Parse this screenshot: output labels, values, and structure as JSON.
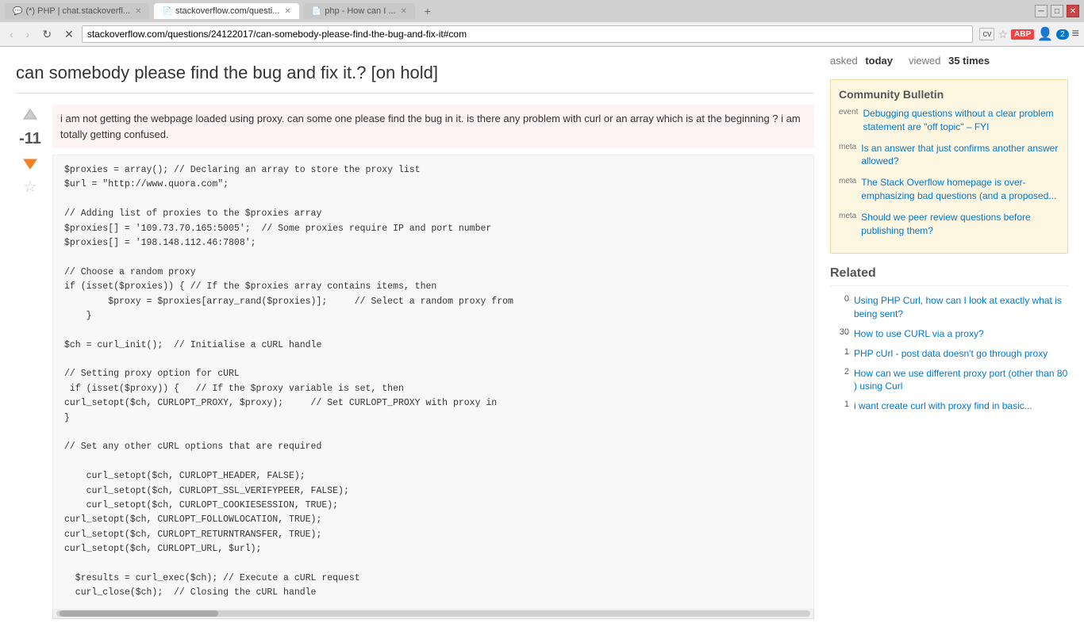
{
  "browser": {
    "tabs": [
      {
        "id": "tab1",
        "label": "(*) PHP | chat.stackoverfl...",
        "favicon": "💬",
        "active": false
      },
      {
        "id": "tab2",
        "label": "stackoverflow.com/questi...",
        "favicon": "📄",
        "active": true
      },
      {
        "id": "tab3",
        "label": "php - How can I ...",
        "favicon": "📄",
        "active": false
      }
    ],
    "win_controls": [
      "─",
      "□",
      "✕"
    ],
    "address": "stackoverflow.com/questions/24122017/can-somebody-please-find-the-bug-and-fix-it#com",
    "nav_icons": [
      "cv",
      "★",
      "ABP",
      "👤",
      "2",
      "≡"
    ]
  },
  "page": {
    "title": "can somebody please find the bug and fix it.? [on hold]",
    "vote_count": "-11",
    "asked_label": "asked",
    "asked_value": "today",
    "viewed_label": "viewed",
    "viewed_value": "35 times",
    "question_text_part1": "i am not getting the webpage loaded using proxy. can some one please find the bug in it. is there any problem with curl or an array which is at the beginning ? i am totally getting confused.",
    "code": "$proxies = array(); // Declaring an array to store the proxy list\n$url = \"http://www.quora.com\";\n\n// Adding list of proxies to the $proxies array\n$proxies[] = '109.73.70.165:5005';  // Some proxies require IP and port number\n$proxies[] = '198.148.112.46:7808';\n\n// Choose a random proxy\nif (isset($proxies)) { // If the $proxies array contains items, then\n        $proxy = $proxies[array_rand($proxies)];     // Select a random proxy from\n    }\n\n$ch = curl_init();  // Initialise a cURL handle\n\n// Setting proxy option for cURL\n if (isset($proxy)) {   // If the $proxy variable is set, then\ncurl_setopt($ch, CURLOPT_PROXY, $proxy);     // Set CURLOPT_PROXY with proxy in\n}\n\n// Set any other cURL options that are required\n\n    curl_setopt($ch, CURLOPT_HEADER, FALSE);\n    curl_setopt($ch, CURLOPT_SSL_VERIFYPEER, FALSE);\n    curl_setopt($ch, CURLOPT_COOKIESESSION, TRUE);\ncurl_setopt($ch, CURLOPT_FOLLOWLOCATION, TRUE);\ncurl_setopt($ch, CURLOPT_RETURNTRANSFER, TRUE);\ncurl_setopt($ch, CURLOPT_URL, $url);\n\n  $results = curl_exec($ch); // Execute a cURL request\n  curl_close($ch);  // Closing the cURL handle"
  },
  "community_bulletin": {
    "title": "Community Bulletin",
    "items": [
      {
        "tag": "event",
        "text": "Debugging questions without a clear problem statement are \"off topic\" – FYI"
      },
      {
        "tag": "meta",
        "text": "Is an answer that just confirms another answer allowed?"
      },
      {
        "tag": "meta",
        "text": "The Stack Overflow homepage is over-emphasizing bad questions (and a proposed..."
      },
      {
        "tag": "meta",
        "text": "Should we peer review questions before publishing them?"
      }
    ]
  },
  "related": {
    "title": "Related",
    "items": [
      {
        "count": "0",
        "text": "Using PHP Curl, how can I look at exactly what is being sent?"
      },
      {
        "count": "30",
        "text": "How to use CURL via a proxy?"
      },
      {
        "count": "1",
        "text": "PHP cUrl - post data doesn't go through proxy"
      },
      {
        "count": "2",
        "text": "How can we use different proxy port (other than 80 ) using Curl"
      },
      {
        "count": "1",
        "text": "i want create curl with proxy find in basic..."
      }
    ]
  }
}
